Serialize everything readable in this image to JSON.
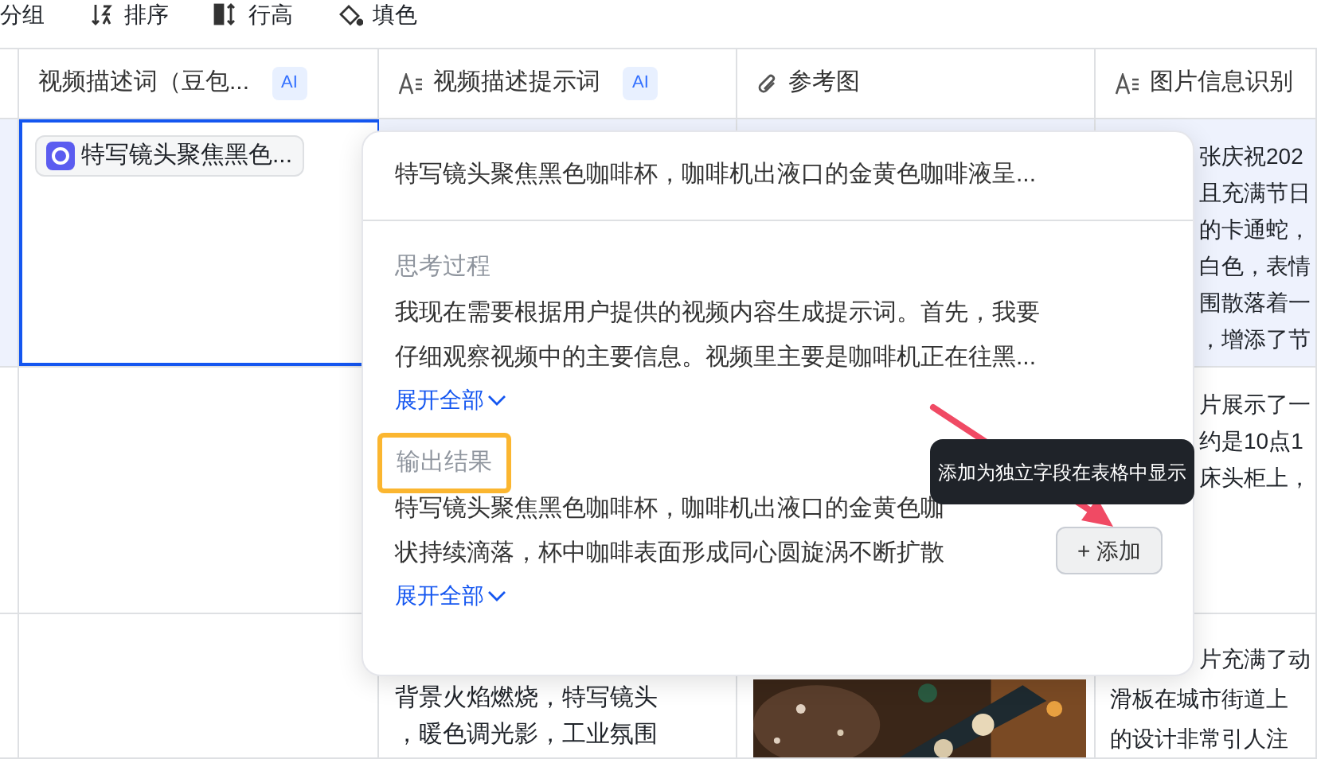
{
  "toolbar": [
    {
      "label": "分组"
    },
    {
      "label": "排序"
    },
    {
      "label": "行高"
    },
    {
      "label": "填色"
    }
  ],
  "columns": [
    {
      "title": "视频描述词（豆包...",
      "kind": "plain",
      "badge": "AI"
    },
    {
      "title": "视频描述提示词",
      "kind": "text",
      "badge": "AI"
    },
    {
      "title": "参考图",
      "kind": "attachment"
    },
    {
      "title": "图片信息识别",
      "kind": "text"
    }
  ],
  "rows": [
    {
      "selected": true,
      "cells": [
        {
          "kind": "chip",
          "text": "特写镜头聚焦黑色..."
        },
        {
          "kind": "empty"
        },
        {
          "kind": "empty"
        },
        {
          "kind": "text",
          "lines": [
            "张庆祝202",
            "且充满节日",
            "的卡通蛇，",
            "白色，表情",
            "围散落着一",
            "，增添了节"
          ]
        }
      ]
    },
    {
      "selected": false,
      "cells": [
        {
          "kind": "empty"
        },
        {
          "kind": "empty"
        },
        {
          "kind": "empty"
        },
        {
          "kind": "text",
          "lines": [
            "片展示了一",
            "约是10点1",
            "床头柜上，"
          ]
        }
      ]
    },
    {
      "selected": false,
      "cells": [
        {
          "kind": "empty"
        },
        {
          "kind": "text",
          "lines": [
            "背景火焰燃烧，特写镜头",
            "，暖色调光影，工业氛围"
          ]
        },
        {
          "kind": "picture"
        },
        {
          "kind": "text",
          "lines": [
            "片充满了动",
            "滑板在城市街道上",
            "的设计非常引人注"
          ]
        }
      ]
    }
  ],
  "popup": {
    "summary": "特写镜头聚焦黑色咖啡杯，咖啡机出液口的金黄色咖啡液呈...",
    "sections": [
      {
        "title": "思考过程",
        "highlighted": false,
        "lines": [
          "我现在需要根据用户提供的视频内容生成提示词。首先，我要",
          "仔细观察视频中的主要信息。视频里主要是咖啡机正在往黑..."
        ],
        "expand": "展开全部"
      },
      {
        "title": "输出结果",
        "highlighted": true,
        "lines": [
          "特写镜头聚焦黑色咖啡杯，咖啡机出液口的金黄色咖",
          "状持续滴落，杯中咖啡表面形成同心圆旋涡不断扩散"
        ],
        "expand": "展开全部"
      }
    ],
    "add_button": "+ 添加",
    "tooltip": "添加为独立字段在表格中显示"
  }
}
